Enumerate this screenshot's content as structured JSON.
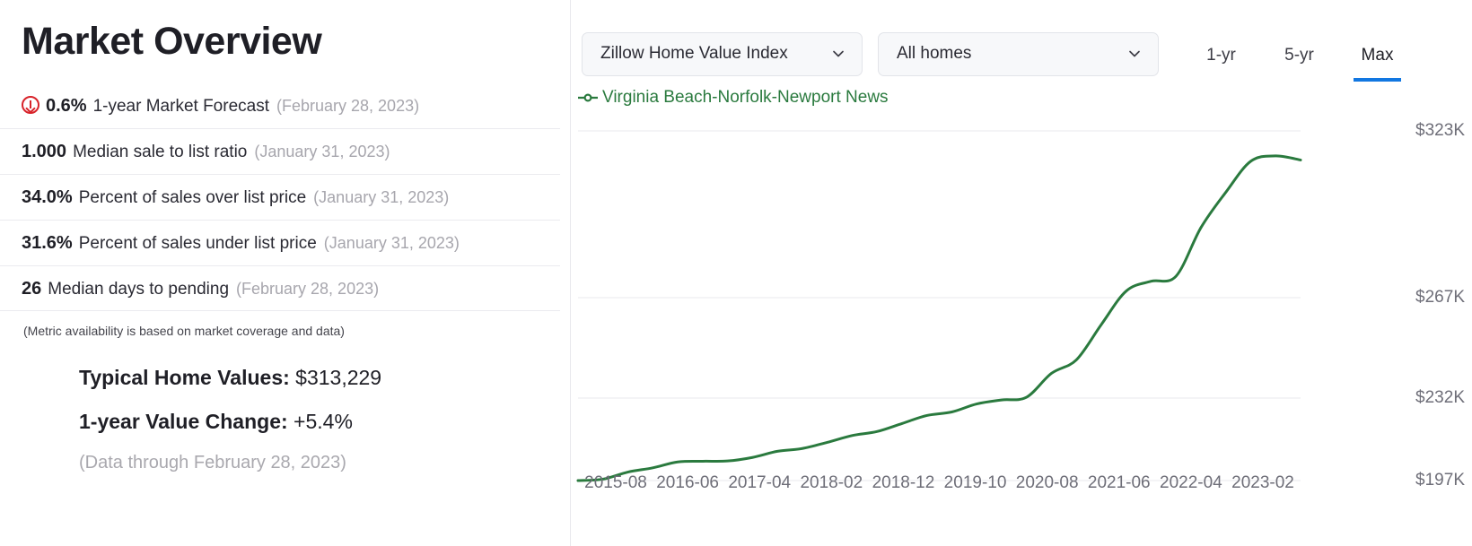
{
  "left": {
    "title": "Market Overview",
    "metrics": [
      {
        "icon": "down-arrow-circle-icon",
        "value": "0.6%",
        "label": "1-year Market Forecast",
        "date": "(February 28, 2023)"
      },
      {
        "icon": null,
        "value": "1.000",
        "label": "Median sale to list ratio",
        "date": "(January 31, 2023)"
      },
      {
        "icon": null,
        "value": "34.0%",
        "label": "Percent of sales over list price",
        "date": "(January 31, 2023)"
      },
      {
        "icon": null,
        "value": "31.6%",
        "label": "Percent of sales under list price",
        "date": "(January 31, 2023)"
      },
      {
        "icon": null,
        "value": "26",
        "label": "Median days to pending",
        "date": "(February 28, 2023)"
      }
    ],
    "availability_note": "(Metric availability is based on market coverage and data)",
    "summary": [
      {
        "label": "Typical Home Values:",
        "value": "$313,229"
      },
      {
        "label": "1-year Value Change:",
        "value": "+5.4%"
      }
    ],
    "summary_note": "(Data through February 28, 2023)"
  },
  "right": {
    "metric_dropdown": {
      "value": "Zillow Home Value Index",
      "icon": "chevron-down-icon"
    },
    "hometype_dropdown": {
      "value": "All homes",
      "icon": "chevron-down-icon"
    },
    "range_tabs": [
      {
        "label": "1-yr",
        "active": false
      },
      {
        "label": "5-yr",
        "active": false
      },
      {
        "label": "Max",
        "active": true
      }
    ],
    "legend": {
      "label": "Virginia Beach-Norfolk-Newport News",
      "color": "#2a7a3e"
    },
    "accent_color": "#1277e1"
  },
  "chart_data": {
    "type": "line",
    "title": "",
    "xlabel": "",
    "ylabel": "",
    "ylim": [
      197000,
      323000
    ],
    "grid": true,
    "legend_position": "top-left",
    "ytick_labels": [
      "$323K",
      "$267K",
      "$232K",
      "$197K"
    ],
    "ytick_values": [
      323000,
      267000,
      232000,
      197000
    ],
    "xtick_labels": [
      "2015-08",
      "2016-06",
      "2017-04",
      "2018-02",
      "2018-12",
      "2019-10",
      "2020-08",
      "2021-06",
      "2022-04",
      "2023-02"
    ],
    "series": [
      {
        "name": "Virginia Beach-Norfolk-Newport News",
        "color": "#2a7a3e",
        "x": [
          "2015-08",
          "2015-12",
          "2016-04",
          "2016-06",
          "2016-10",
          "2017-02",
          "2017-04",
          "2017-08",
          "2017-12",
          "2018-02",
          "2018-06",
          "2018-10",
          "2018-12",
          "2019-04",
          "2019-08",
          "2019-10",
          "2020-02",
          "2020-06",
          "2020-08",
          "2020-12",
          "2021-02",
          "2021-06",
          "2021-10",
          "2021-12",
          "2022-02",
          "2022-06",
          "2022-08",
          "2022-10",
          "2022-12",
          "2023-02"
        ],
        "values": [
          196800,
          197600,
          200600,
          202400,
          204900,
          205200,
          205300,
          206800,
          209400,
          210600,
          213200,
          216100,
          217800,
          221200,
          224600,
          226100,
          229500,
          231200,
          232300,
          240600,
          245300,
          257600,
          269200,
          272500,
          274200,
          290500,
          302400,
          312800,
          314600,
          313229
        ]
      }
    ]
  }
}
